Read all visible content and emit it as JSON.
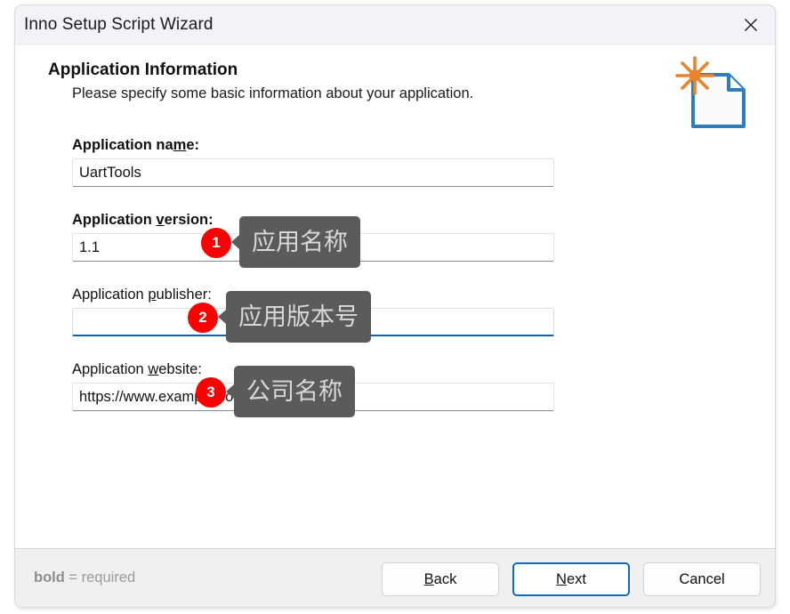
{
  "window": {
    "title": "Inno Setup Script Wizard",
    "close_icon": "close-icon"
  },
  "header": {
    "title": "Application Information",
    "subtitle": "Please specify some basic information about your application.",
    "icon": "new-script-page-icon"
  },
  "form": {
    "fields": [
      {
        "label_pre": "Application na",
        "label_mnemonic": "m",
        "label_post": "e:",
        "bold": true,
        "value": "UartTools",
        "placeholder": "",
        "focused": false
      },
      {
        "label_pre": "Application ",
        "label_mnemonic": "v",
        "label_post": "ersion:",
        "bold": true,
        "value": "1.1",
        "placeholder": "",
        "focused": false
      },
      {
        "label_pre": "Application ",
        "label_mnemonic": "p",
        "label_post": "ublisher:",
        "bold": false,
        "value": "",
        "placeholder": "",
        "focused": true
      },
      {
        "label_pre": "Application ",
        "label_mnemonic": "w",
        "label_post": "ebsite:",
        "bold": false,
        "value": "https://www.example.com/",
        "placeholder": "",
        "focused": false
      }
    ]
  },
  "annotations": [
    {
      "number": "1",
      "tooltip": "应用名称"
    },
    {
      "number": "2",
      "tooltip": "应用版本号"
    },
    {
      "number": "3",
      "tooltip": "公司名称"
    }
  ],
  "footer": {
    "required_bold": "bold",
    "required_rest": " = required",
    "buttons": [
      {
        "pre": "",
        "mnemonic": "B",
        "post": "ack",
        "focused": false
      },
      {
        "pre": "",
        "mnemonic": "N",
        "post": "ext",
        "focused": true
      },
      {
        "pre": "Cancel",
        "mnemonic": "",
        "post": "",
        "focused": false
      }
    ]
  },
  "colors": {
    "badge_red": "#fa0000",
    "tooltip_bg": "#5b5b5b",
    "tooltip_text": "#d8d8d8",
    "focus_blue": "#0067c0",
    "icon_blue": "#2e7ebd",
    "icon_orange": "#e8842b",
    "titlebar_bg": "#f2f3f8",
    "footer_bg": "#f0f0f0"
  }
}
